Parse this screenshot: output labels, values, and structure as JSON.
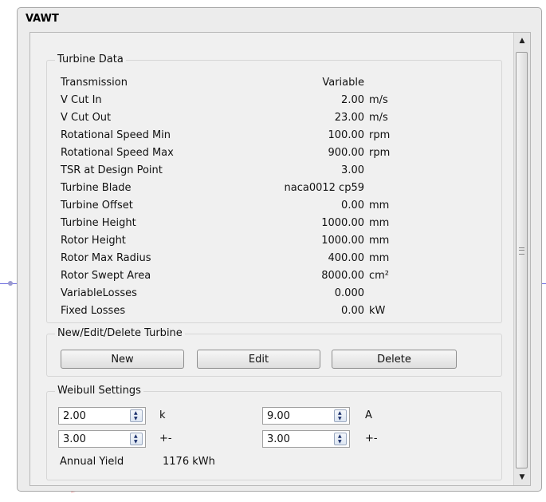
{
  "window": {
    "title": "VAWT"
  },
  "turbine_data": {
    "title": "Turbine Data",
    "rows": [
      {
        "label": "Transmission",
        "value": "Variable",
        "unit": ""
      },
      {
        "label": "V Cut In",
        "value": "2.00",
        "unit": "m/s"
      },
      {
        "label": "V Cut Out",
        "value": "23.00",
        "unit": "m/s"
      },
      {
        "label": "Rotational Speed Min",
        "value": "100.00",
        "unit": "rpm"
      },
      {
        "label": "Rotational Speed Max",
        "value": "900.00",
        "unit": "rpm"
      },
      {
        "label": "TSR at Design Point",
        "value": "3.00",
        "unit": ""
      },
      {
        "label": "Turbine Blade",
        "value": "naca0012 cp59",
        "unit": ""
      },
      {
        "label": "Turbine Offset",
        "value": "0.00",
        "unit": "mm"
      },
      {
        "label": "Turbine Height",
        "value": "1000.00",
        "unit": "mm"
      },
      {
        "label": "Rotor Height",
        "value": "1000.00",
        "unit": "mm"
      },
      {
        "label": "Rotor Max Radius",
        "value": "400.00",
        "unit": "mm"
      },
      {
        "label": "Rotor Swept Area",
        "value": "8000.00",
        "unit": "cm²"
      },
      {
        "label": "VariableLosses",
        "value": "0.000",
        "unit": ""
      },
      {
        "label": "Fixed Losses",
        "value": "0.00",
        "unit": "kW"
      }
    ]
  },
  "edit_turbine": {
    "title": "New/Edit/Delete Turbine",
    "new_label": "New",
    "edit_label": "Edit",
    "delete_label": "Delete"
  },
  "weibull": {
    "title": "Weibull Settings",
    "k_value": "2.00",
    "k_label": "k",
    "k_tol_value": "3.00",
    "k_tol_label": "+-",
    "a_value": "9.00",
    "a_label": "A",
    "a_tol_value": "3.00",
    "a_tol_label": "+-",
    "annual_yield_label": "Annual Yield",
    "annual_yield_value": "1176 kWh"
  },
  "icons": [
    "scroll-up-icon",
    "scroll-down-icon",
    "spin-up-icon",
    "spin-down-icon"
  ]
}
